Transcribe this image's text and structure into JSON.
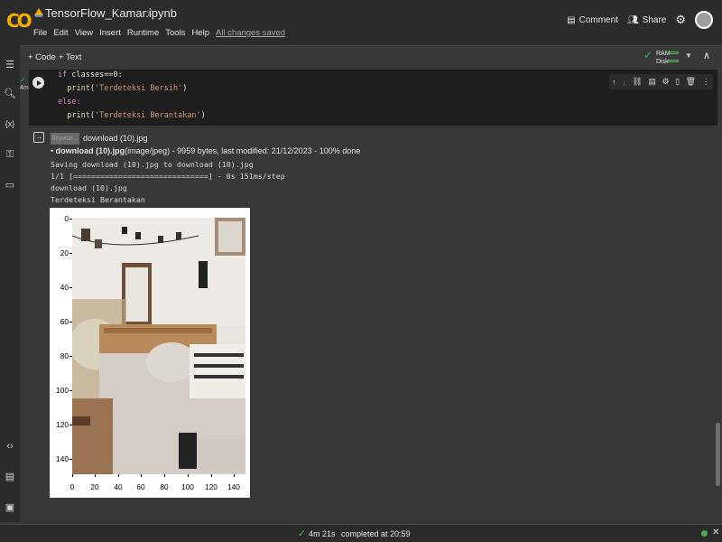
{
  "app": {
    "notebook_title": "TensorFlow_Kamar.ipynb",
    "menu": [
      "File",
      "Edit",
      "View",
      "Insert",
      "Runtime",
      "Tools",
      "Help"
    ],
    "save_status": "All changes saved"
  },
  "header": {
    "comment_label": "Comment",
    "share_label": "Share"
  },
  "toolbar": {
    "add_code": "+ Code",
    "add_text": "+ Text",
    "ram_label": "RAM",
    "disk_label": "Disk"
  },
  "cell": {
    "exec_time": "4m",
    "code_lines": {
      "l1_kw": "if",
      "l1_rest": " classes==0:",
      "l2_fn": "print",
      "l2_str": "'Terdeteksi Bersih'",
      "l3_kw": "else:",
      "l4_fn": "print",
      "l4_str": "'Terdeteksi Berantakan'"
    }
  },
  "output": {
    "browse_label": "Browse...",
    "selected_file": "download (10).jpg",
    "upload_name": "download (10).jpg",
    "upload_info": "(image/jpeg) - 9959 bytes, last modified: 21/12/2023 - 100% done",
    "saving_line": "Saving download (10).jpg to download (10).jpg",
    "progress_line": "1/1 [==============================] - 0s 151ms/step",
    "filename_line": "download (10).jpg",
    "result_line": "Terdeteksi Berantakan"
  },
  "plot": {
    "y_ticks": [
      "0",
      "20",
      "40",
      "60",
      "80",
      "100",
      "120",
      "140"
    ],
    "x_ticks": [
      "0",
      "20",
      "40",
      "60",
      "80",
      "100",
      "120",
      "140"
    ]
  },
  "statusbar": {
    "elapsed": "4m 21s",
    "completed": "completed at 20:59"
  },
  "colors": {
    "accent_green": "#4caf50",
    "logo_orange": "#f9ab00"
  }
}
